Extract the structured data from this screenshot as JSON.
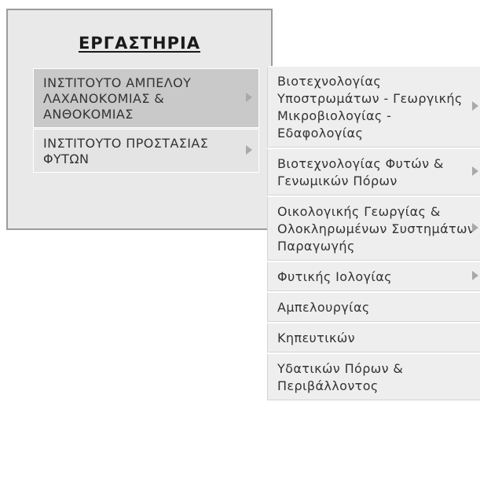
{
  "panel": {
    "title": "ΕΡΓΑΣΤΗΡΙΑ"
  },
  "menu": {
    "items": [
      {
        "label": "ΙΝΣΤΙΤΟΥΤΟ ΑΜΠΕΛΟΥ ΛΑΧΑΝΟΚΟΜΙΑΣ & ΑΝΘΟΚΟΜΙΑΣ",
        "has_submenu": true,
        "active": true
      },
      {
        "label": "ΙΝΣΤΙΤΟΥΤΟ ΠΡΟΣΤΑΣΙΑΣ ΦΥΤΩΝ",
        "has_submenu": true,
        "active": false
      }
    ]
  },
  "submenu": {
    "items": [
      {
        "label": "Βιοτεχνολογίας Υποστρωμάτων - Γεωργικής Μικροβιολογίας - Εδαφολογίας",
        "has_submenu": true
      },
      {
        "label": "Βιοτεχνολογίας Φυτών & Γενωμικών Πόρων",
        "has_submenu": true
      },
      {
        "label": "Οικολογικής Γεωργίας & Ολοκληρωμένων Συστημάτων Παραγωγής",
        "has_submenu": true
      },
      {
        "label": "Φυτικής Ιολογίας",
        "has_submenu": true
      },
      {
        "label": "Αμπελουργίας",
        "has_submenu": false
      },
      {
        "label": "Κηπευτικών",
        "has_submenu": false
      },
      {
        "label": "Υδατικών Πόρων & Περιβάλλοντος",
        "has_submenu": false
      }
    ]
  },
  "colors": {
    "panel_bg": "#e9e9e9",
    "panel_border": "#9c9c9c",
    "item_bg": "#e4e4e4",
    "item_active_bg": "#c9c9c9",
    "submenu_item_bg": "#eeeeee",
    "arrow": "#a9a9a9",
    "text": "#333333"
  },
  "icons": {
    "submenu_indicator": "arrow-right-icon"
  }
}
